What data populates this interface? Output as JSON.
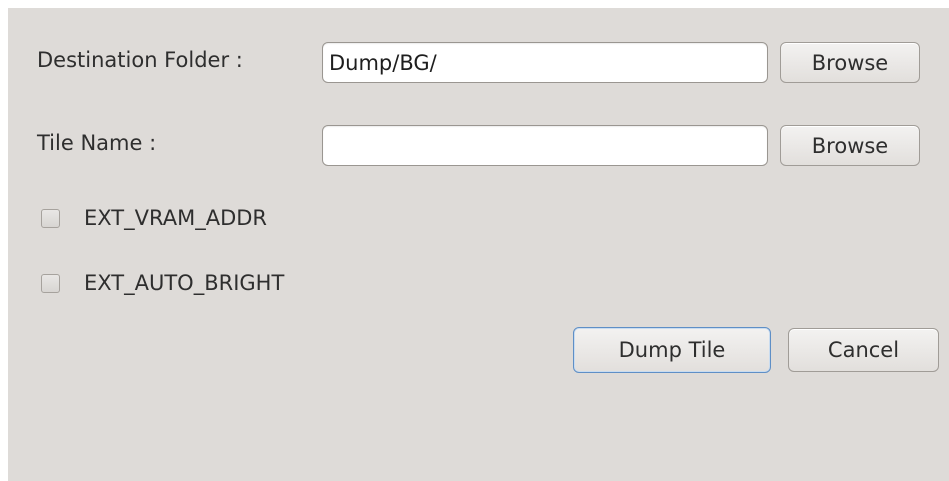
{
  "form": {
    "destination_label": "Destination Folder :",
    "destination_value": "Dump/BG/",
    "destination_browse_label": "Browse",
    "tile_name_label": "Tile Name :",
    "tile_name_value": "",
    "tile_name_browse_label": "Browse",
    "options": [
      {
        "label": "EXT_VRAM_ADDR",
        "checked": false
      },
      {
        "label": "EXT_AUTO_BRIGHT",
        "checked": false
      }
    ]
  },
  "actions": {
    "dump_tile_label": "Dump Tile",
    "cancel_label": "Cancel"
  },
  "colors": {
    "background": "#dedbd8",
    "default_button_border": "#5f8fc6"
  }
}
